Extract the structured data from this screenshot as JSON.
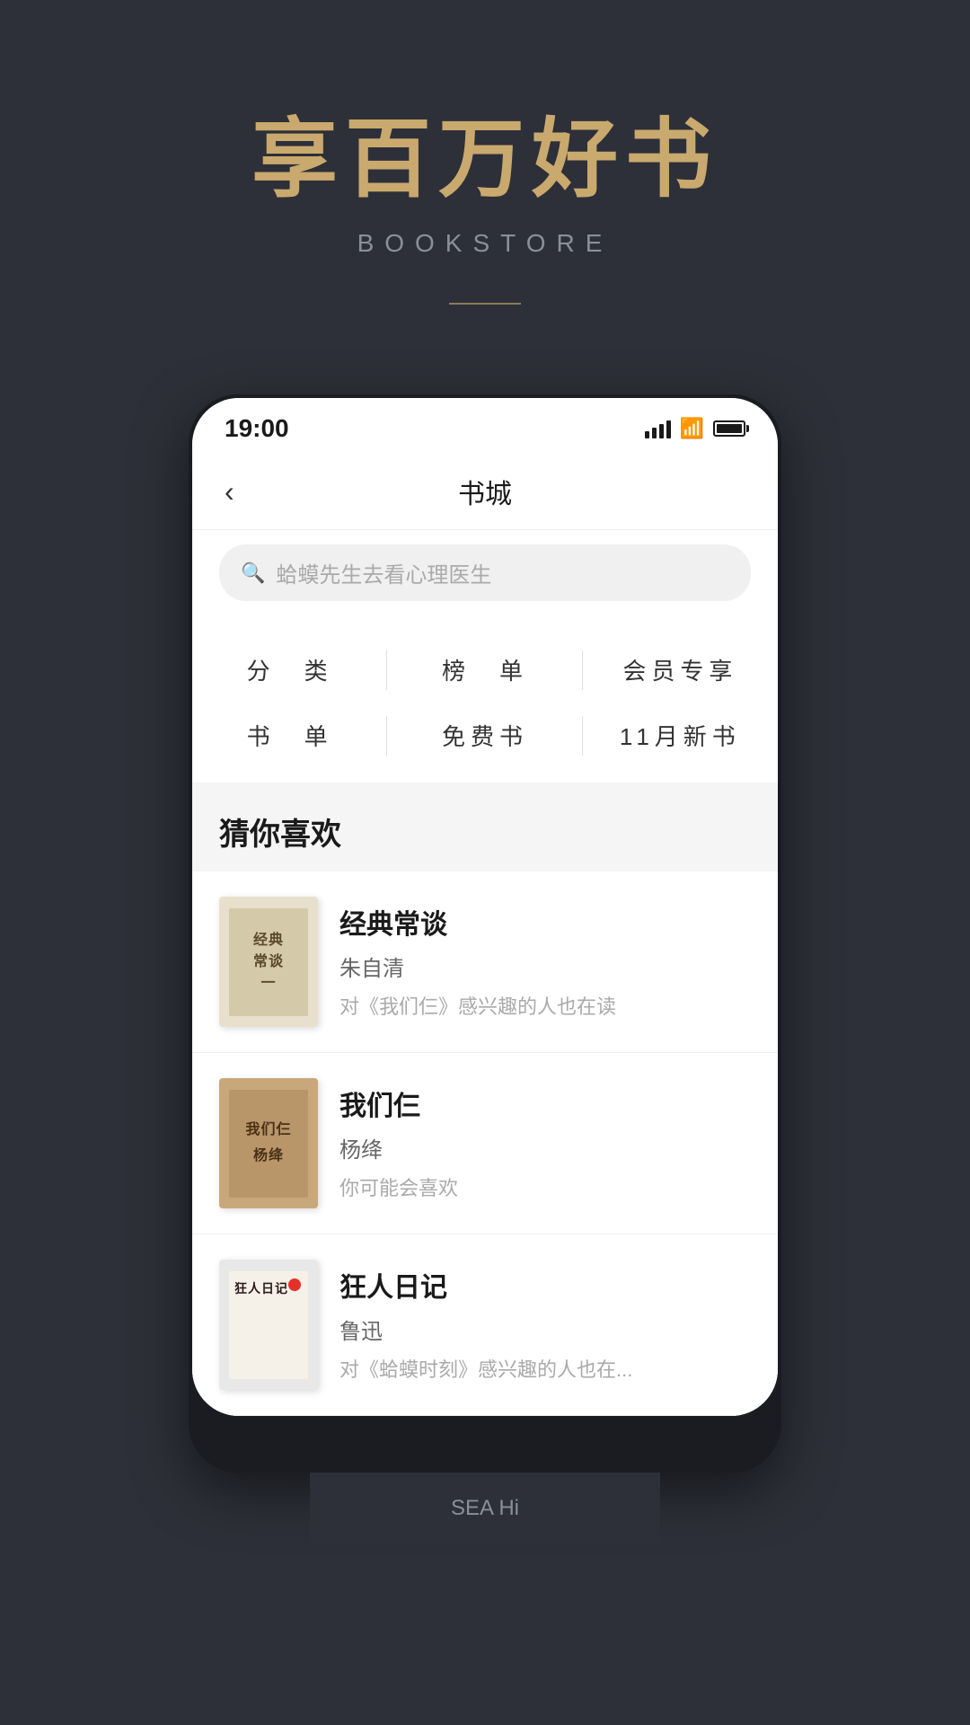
{
  "background_color": "#2d3038",
  "header": {
    "main_title": "享百万好书",
    "subtitle": "BOOKSTORE"
  },
  "status_bar": {
    "time": "19:00"
  },
  "nav": {
    "title": "书城",
    "back_label": "‹"
  },
  "search": {
    "placeholder": "蛤蟆先生去看心理医生"
  },
  "categories": [
    {
      "label": "分　类"
    },
    {
      "label": "榜　单"
    },
    {
      "label": "会员专享"
    },
    {
      "label": "书　单"
    },
    {
      "label": "免费书"
    },
    {
      "label": "11月新书"
    }
  ],
  "recommendation": {
    "title": "猜你喜欢",
    "books": [
      {
        "title": "经典常谈",
        "author": "朱自清",
        "desc": "对《我们仨》感兴趣的人也在读",
        "cover_text_line1": "经典",
        "cover_text_line2": "常谈",
        "cover_text_line3": "一"
      },
      {
        "title": "我们仨",
        "author": "杨绛",
        "desc": "你可能会喜欢",
        "cover_text_line1": "我们仨",
        "cover_text_line2": "杨绛"
      },
      {
        "title": "狂人日记",
        "author": "鲁迅",
        "desc": "对《蛤蟆时刻》感兴趣的人也在...",
        "cover_text_line1": "狂人日记"
      }
    ]
  },
  "bottom_partial_text": "SEA Hi"
}
